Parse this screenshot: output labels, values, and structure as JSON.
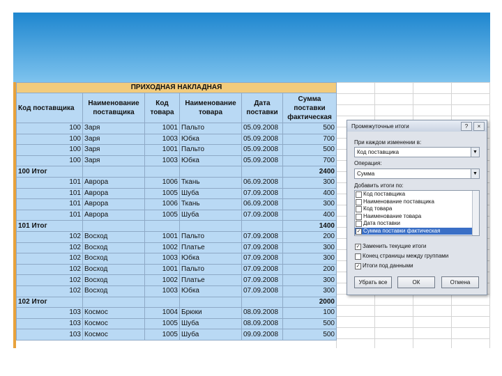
{
  "table": {
    "title": "ПРИХОДНАЯ НАКЛАДНАЯ",
    "headers": [
      "Код поставщика",
      "Наименование поставщика",
      "Код товара",
      "Наименование товара",
      "Дата поставки",
      "Сумма поставки фактическая"
    ],
    "rows": [
      [
        "100",
        "Заря",
        "1001",
        "Пальто",
        "05.09.2008",
        "500"
      ],
      [
        "100",
        "Заря",
        "1003",
        "Юбка",
        "05.09.2008",
        "700"
      ],
      [
        "100",
        "Заря",
        "1001",
        "Пальто",
        "05.09.2008",
        "500"
      ],
      [
        "100",
        "Заря",
        "1003",
        "Юбка",
        "05.09.2008",
        "700"
      ],
      [
        "100 Итог",
        "",
        "",
        "",
        "",
        "2400"
      ],
      [
        "101",
        "Аврора",
        "1006",
        "Ткань",
        "06.09.2008",
        "300"
      ],
      [
        "101",
        "Аврора",
        "1005",
        "Шуба",
        "07.09.2008",
        "400"
      ],
      [
        "101",
        "Аврора",
        "1006",
        "Ткань",
        "06.09.2008",
        "300"
      ],
      [
        "101",
        "Аврора",
        "1005",
        "Шуба",
        "07.09.2008",
        "400"
      ],
      [
        "101 Итог",
        "",
        "",
        "",
        "",
        "1400"
      ],
      [
        "102",
        "Восход",
        "1001",
        "Пальто",
        "07.09.2008",
        "200"
      ],
      [
        "102",
        "Восход",
        "1002",
        "Платье",
        "07.09.2008",
        "300"
      ],
      [
        "102",
        "Восход",
        "1003",
        "Юбка",
        "07.09.2008",
        "300"
      ],
      [
        "102",
        "Восход",
        "1001",
        "Пальто",
        "07.09.2008",
        "200"
      ],
      [
        "102",
        "Восход",
        "1002",
        "Платье",
        "07.09.2008",
        "300"
      ],
      [
        "102",
        "Восход",
        "1003",
        "Юбка",
        "07.09.2008",
        "300"
      ],
      [
        "102 Итог",
        "",
        "",
        "",
        "",
        "2000"
      ],
      [
        "103",
        "Космос",
        "1004",
        "Брюки",
        "08.09.2008",
        "100"
      ],
      [
        "103",
        "Космос",
        "1005",
        "Шуба",
        "08.09.2008",
        "500"
      ],
      [
        "103",
        "Космос",
        "1005",
        "Шуба",
        "09.09.2008",
        "500"
      ]
    ]
  },
  "dialog": {
    "title": "Промежуточные итоги",
    "help_glyph": "?",
    "close_glyph": "×",
    "group_label": "При каждом изменении в:",
    "group_value": "Код поставщика",
    "func_label": "Операция:",
    "func_value": "Сумма",
    "add_label": "Добавить итоги по:",
    "add_items": [
      {
        "label": "Код поставщика",
        "checked": false
      },
      {
        "label": "Наименование поставщика",
        "checked": false
      },
      {
        "label": "Код товара",
        "checked": false
      },
      {
        "label": "Наименование товара",
        "checked": false
      },
      {
        "label": "Дата поставки",
        "checked": false
      },
      {
        "label": "Сумма поставки фактическая",
        "checked": true
      }
    ],
    "options": [
      {
        "label": "Заменить текущие итоги",
        "checked": true
      },
      {
        "label": "Конец страницы между группами",
        "checked": false
      },
      {
        "label": "Итоги под данными",
        "checked": true
      }
    ],
    "buttons": {
      "remove_all": "Убрать все",
      "ok": "ОК",
      "cancel": "Отмена"
    }
  }
}
